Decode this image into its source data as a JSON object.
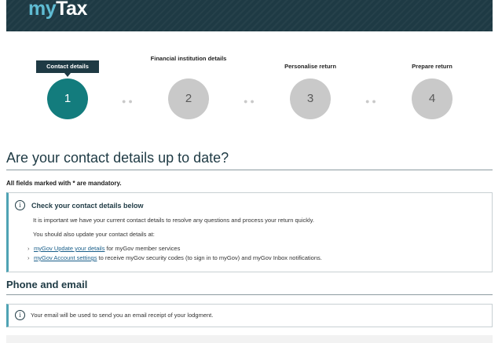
{
  "brand": {
    "logo_my": "my",
    "logo_tax": "Tax"
  },
  "steps": [
    {
      "label": "Contact details",
      "number": "1",
      "active": true
    },
    {
      "label": "Financial institution details",
      "number": "2",
      "active": false
    },
    {
      "label": "Personalise return",
      "number": "3",
      "active": false
    },
    {
      "label": "Prepare return",
      "number": "4",
      "active": false
    }
  ],
  "page": {
    "title": "Are your contact details up to date?",
    "mandatory_note": "All fields marked with * are mandatory."
  },
  "info_box": {
    "icon": "info-icon",
    "title": "Check your contact details below",
    "line1": "It is important we have your current contact details to resolve any questions and process your return quickly.",
    "line2": "You should also update your contact details at:",
    "links": [
      {
        "link_text": "myGov Update your details",
        "rest": " for myGov member services"
      },
      {
        "link_text": "myGov Account settings",
        "rest": " to receive myGov security codes (to sign in to myGov) and myGov Inbox notifications."
      }
    ]
  },
  "section": {
    "title": "Phone and email"
  },
  "email_note": {
    "icon": "info-icon",
    "text": "Your email will be used to send you an email receipt of your lodgment."
  },
  "colors": {
    "header": "#1e3a44",
    "active_step": "#137c7d",
    "inactive_step": "#c9c9c9",
    "link": "#1a5f8a"
  }
}
